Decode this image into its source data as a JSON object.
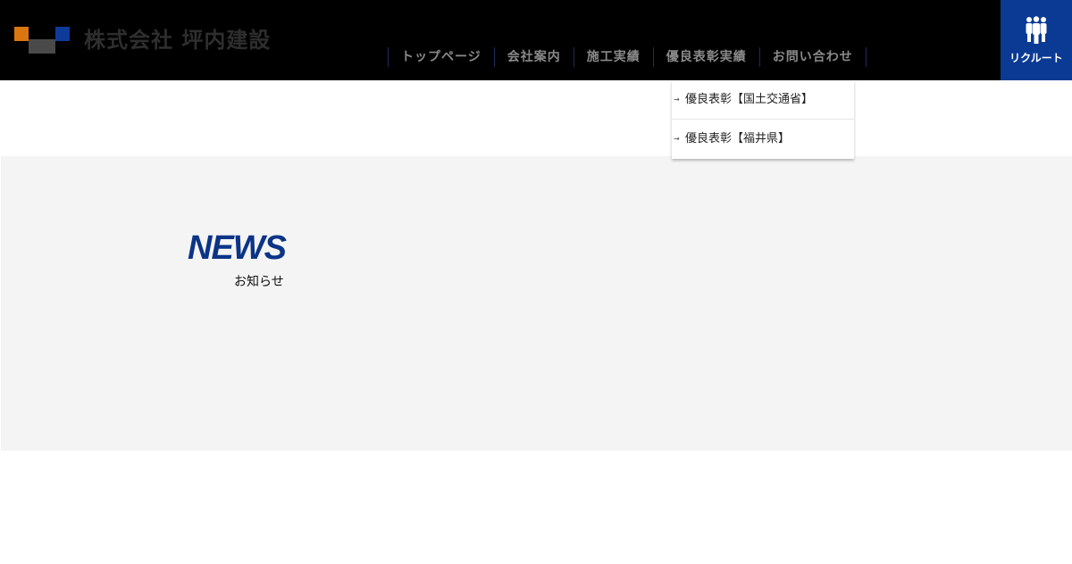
{
  "header": {
    "logo_text": "株式会社 坪内建設",
    "brand_colors": {
      "orange": "#d9760f",
      "gray": "#4a4a4a",
      "blue": "#0e3a9a"
    },
    "nav": [
      {
        "label": "トップページ"
      },
      {
        "label": "会社案内"
      },
      {
        "label": "施工実績"
      },
      {
        "label": "優良表彰実績"
      },
      {
        "label": "お問い合わせ"
      }
    ],
    "recruit": {
      "label": "リクルート",
      "icon": "people-icon",
      "color": "#0a3a94"
    }
  },
  "dropdown": {
    "items": [
      {
        "label": "優良表彰【国土交通省】"
      },
      {
        "label": "優良表彰【福井県】"
      }
    ]
  },
  "news": {
    "title": "NEWS",
    "subtitle": "お知らせ",
    "title_color": "#0b3487"
  }
}
